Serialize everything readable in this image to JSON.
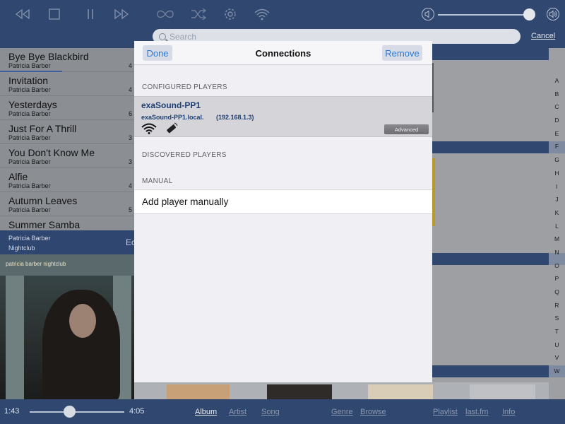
{
  "toolbar": {
    "search_placeholder": "Search",
    "cancel_label": "Cancel",
    "volume_level": 0.95
  },
  "songs": [
    {
      "title": "Bye Bye Blackbird",
      "artist": "Patricia Barber",
      "duration": "4"
    },
    {
      "title": "Invitation",
      "artist": "Patricia Barber",
      "duration": "4"
    },
    {
      "title": "Yesterdays",
      "artist": "Patricia Barber",
      "duration": "6"
    },
    {
      "title": "Just For A Thrill",
      "artist": "Patricia Barber",
      "duration": "3"
    },
    {
      "title": "You Don't Know Me",
      "artist": "Patricia Barber",
      "duration": "3"
    },
    {
      "title": "Alfie",
      "artist": "Patricia Barber",
      "duration": "4"
    },
    {
      "title": "Autumn Leaves",
      "artist": "Patricia Barber",
      "duration": "5"
    },
    {
      "title": "Summer Samba",
      "artist": "",
      "duration": ""
    }
  ],
  "now_playing": {
    "artist": "Patricia Barber",
    "album": "Nightclub",
    "edge_text": "Ec",
    "cover_text": "patricia barber nightclub"
  },
  "alphabet": [
    "A",
    "B",
    "C",
    "D",
    "E",
    "F",
    "G",
    "H",
    "I",
    "J",
    "K",
    "L",
    "M",
    "N",
    "O",
    "P",
    "Q",
    "R",
    "S",
    "T",
    "U",
    "V",
    "W"
  ],
  "player": {
    "elapsed": "1:43",
    "total": "4:05",
    "progress": 0.42
  },
  "bottom_nav": {
    "album": "Album",
    "artist": "Artist",
    "song": "Song",
    "genre": "Genre",
    "browse": "Browse",
    "playlist": "Playlist",
    "lastfm": "last.fm",
    "info": "Info"
  },
  "modal": {
    "title": "Connections",
    "done_label": "Done",
    "remove_label": "Remove",
    "configured_header": "CONFIGURED PLAYERS",
    "discovered_header": "DISCOVERED PLAYERS",
    "manual_header": "MANUAL",
    "configured_player": {
      "name": "exaSound-PP1",
      "host": "exaSound-PP1.local.",
      "ip": "(192.168.1.3)",
      "advanced_label": "Advanced"
    },
    "add_manually_label": "Add player manually"
  },
  "colors": {
    "bar_blue": "#30476f",
    "accent_blue": "#2c7bd6",
    "player_text": "#1d3f73"
  }
}
